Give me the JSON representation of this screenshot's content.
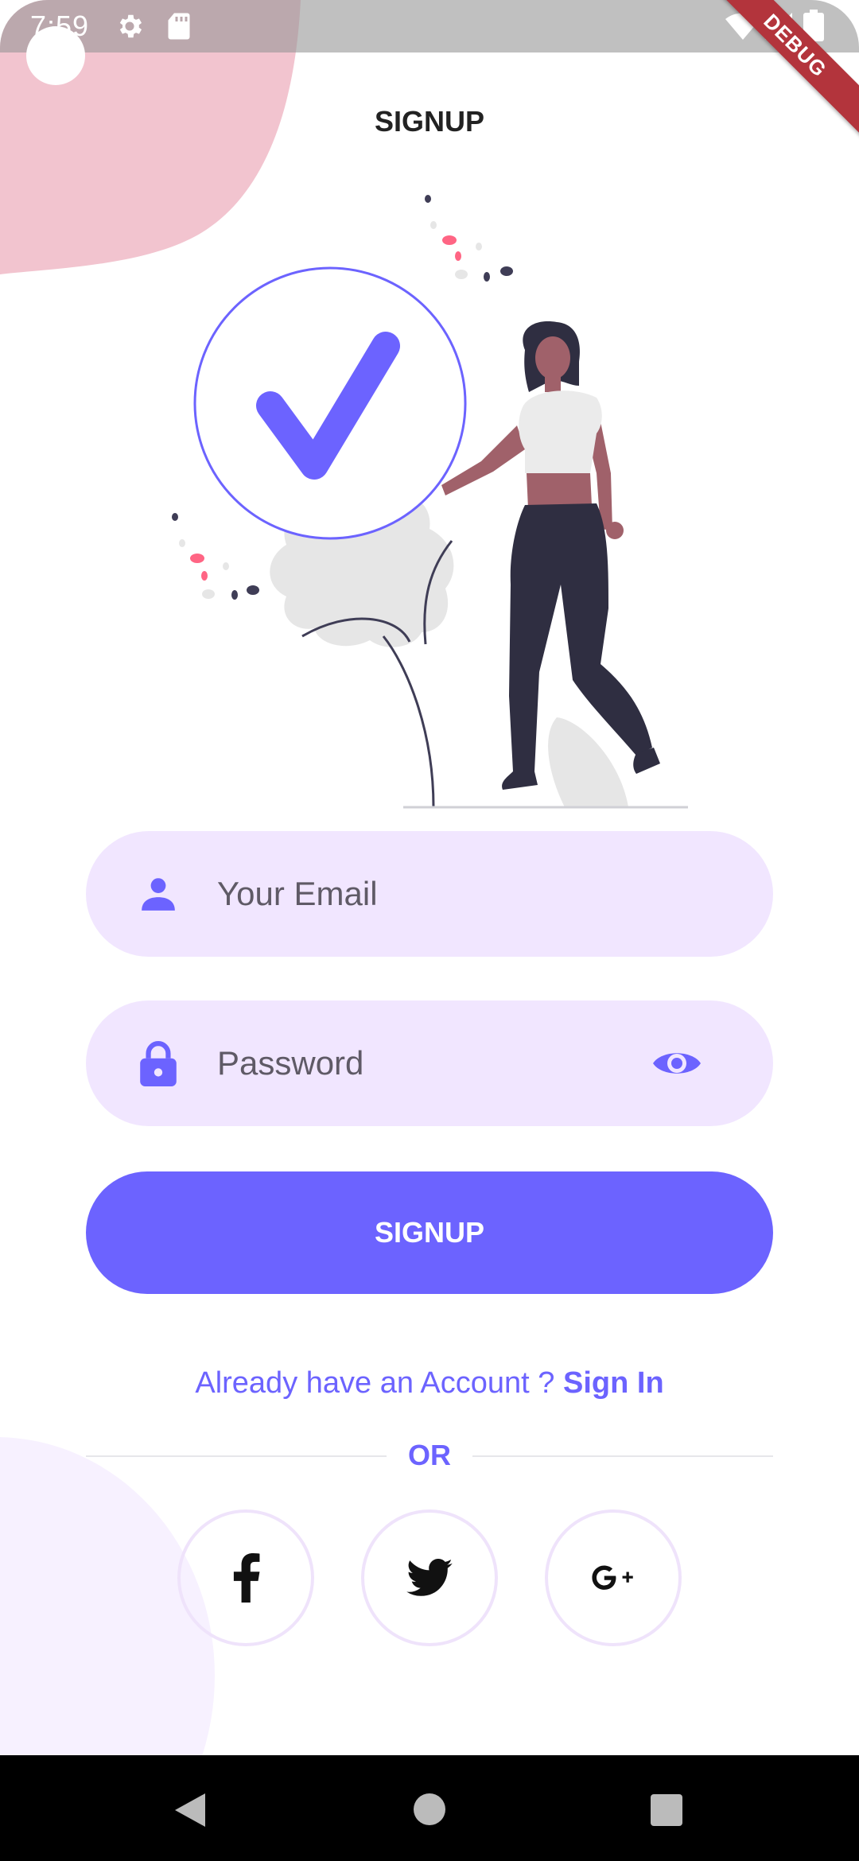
{
  "status_bar": {
    "time": "7:59"
  },
  "debug_banner": "DEBUG",
  "header": {
    "title": "SIGNUP"
  },
  "form": {
    "email_placeholder": "Your Email",
    "password_placeholder": "Password",
    "submit_label": "SIGNUP"
  },
  "account_prompt": {
    "text": "Already have an Account ? ",
    "link": "Sign In"
  },
  "divider": {
    "label": "OR"
  },
  "social": [
    "facebook-icon",
    "twitter-icon",
    "google-plus-icon"
  ],
  "colors": {
    "primary": "#6c63ff",
    "field_bg": "#f1e6ff",
    "top_blob": "#f2c4cf",
    "bottom_blob": "#f7f1ff"
  }
}
